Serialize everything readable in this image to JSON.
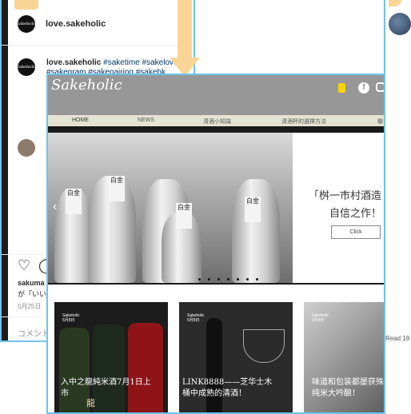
{
  "instagram": {
    "username": "love.sakeholic",
    "logo_text": "Sakeholic",
    "more_icon": "...",
    "caption_user": "love.sakeholic",
    "caption_tags_line1": "#saketime #sakelove",
    "caption_tags_line2": "#sakegram #sakepairing #sakehk",
    "likes_user": "sakuma",
    "likes_text": "が「いい",
    "date": "5月25日",
    "comment_placeholder": "コメント"
  },
  "right_card": {
    "read_text": "Read 19"
  },
  "website": {
    "logo": "Sakeholic",
    "nav": [
      "HOME",
      "NEWS",
      "清酒小知識",
      "清酒杯的選擇方法",
      "聯"
    ],
    "hero_line1": "「桝一市村酒造",
    "hero_line2": "自信之作！",
    "click_label": "Click",
    "bottle_label": "白金",
    "tiles": [
      {
        "author": "Sakeholic",
        "date": "5月8日",
        "title_line1": "入中之龍純米酒7月1日上",
        "title_line2": "市"
      },
      {
        "author": "Sakeholic",
        "date": "5月8日",
        "title_line1": "LINK8888——芝华士木",
        "title_line2": "桶中成熟的清酒！"
      },
      {
        "author": "Sakeholic",
        "date": "5月8日",
        "title_line1": "味道和包装都屡获殊荣的",
        "title_line2": "纯米大吟酿！"
      }
    ],
    "tile1_bottle_text": "龍"
  }
}
